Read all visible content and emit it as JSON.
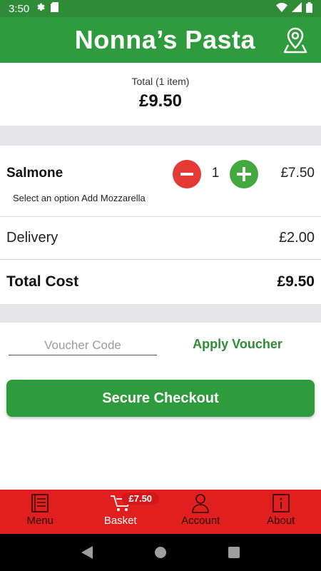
{
  "status_bar": {
    "time": "3:50",
    "icons": [
      "gear-icon",
      "sdcard-icon",
      "wifi-icon",
      "signal-icon",
      "battery-icon"
    ]
  },
  "header": {
    "title": "Nonna’s Pasta",
    "location_icon": "map-pin-icon",
    "color": "#2e9b3c"
  },
  "summary": {
    "label": "Total (1 item)",
    "amount": "£9.50"
  },
  "basket": {
    "items": [
      {
        "name": "Salmone",
        "option": "Select an option Add Mozzarella",
        "quantity": "1",
        "price": "£7.50"
      }
    ],
    "delivery_label": "Delivery",
    "delivery_price": "£2.00",
    "total_label": "Total Cost",
    "total_price": "£9.50"
  },
  "voucher": {
    "placeholder": "Voucher Code",
    "value": "",
    "apply_label": "Apply Voucher"
  },
  "checkout": {
    "label": "Secure Checkout"
  },
  "bottom_nav": {
    "items": [
      {
        "label": "Menu",
        "icon": "menu-book-icon"
      },
      {
        "label": "Basket",
        "icon": "cart-icon",
        "active": true,
        "badge": "£7.50"
      },
      {
        "label": "Account",
        "icon": "person-icon"
      },
      {
        "label": "About",
        "icon": "info-icon"
      }
    ],
    "color": "#e11f1f"
  },
  "accent_colors": {
    "primary_green": "#2e9b3c",
    "minus_red": "#e53935",
    "plus_green": "#43a83d"
  }
}
